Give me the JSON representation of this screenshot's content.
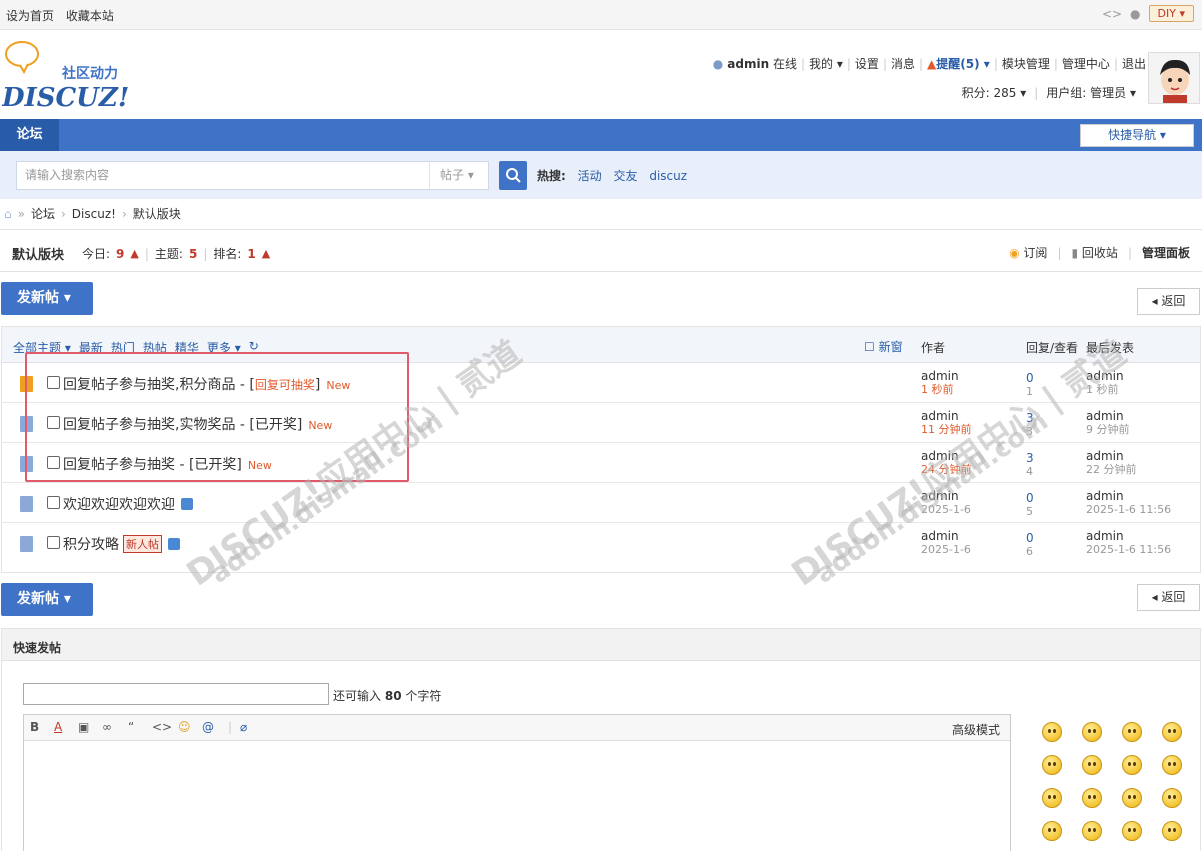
{
  "topbar": {
    "set_home": "设为首页",
    "bookmark": "收藏本站",
    "diy": "DIY"
  },
  "header": {
    "logo_text": "社区动力",
    "logo_word": "DISCUZ!",
    "user": "admin",
    "online": "在线",
    "mine": "我的",
    "settings": "设置",
    "messages": "消息",
    "remind": "提醒(5)",
    "module_manage": "模块管理",
    "admin_center": "管理中心",
    "logout": "退出",
    "credits": "积分: 285",
    "usergroup": "用户组: 管理员"
  },
  "nav": {
    "forum_tab": "论坛",
    "quick_nav": "快捷导航"
  },
  "search": {
    "placeholder": "请输入搜索内容",
    "type": "帖子",
    "hot_label": "热搜:",
    "hot": [
      "活动",
      "交友",
      "discuz"
    ]
  },
  "breadcrumb": [
    "论坛",
    "Discuz!",
    "默认版块"
  ],
  "forum": {
    "name": "默认版块",
    "today_label": "今日:",
    "today": "9",
    "topics_label": "主题:",
    "topics": "5",
    "rank_label": "排名:",
    "rank": "1",
    "subscribe": "订阅",
    "recycle": "回收站",
    "manage_panel": "管理面板"
  },
  "buttons": {
    "new_post": "发新帖",
    "back": "返回"
  },
  "threadlist": {
    "filters": [
      "全部主题",
      "最新",
      "热门",
      "热帖",
      "精华",
      "更多"
    ],
    "new_window": "新窗",
    "col_author": "作者",
    "col_reply": "回复/查看",
    "col_last": "最后发表",
    "rows": [
      {
        "title": "回复帖子参与抽奖,积分商品 - [",
        "tag": "回复可抽奖",
        "tag_close": "]",
        "new": "New",
        "author": "admin",
        "date": "1 秒前",
        "replies": "0",
        "views": "1",
        "last_user": "admin",
        "last_date": "1 秒前"
      },
      {
        "title": "回复帖子参与抽奖,实物奖品 - [已开奖]",
        "new": "New",
        "author": "admin",
        "date": "11 分钟前",
        "replies": "3",
        "views": "3",
        "last_user": "admin",
        "last_date": "9 分钟前"
      },
      {
        "title": "回复帖子参与抽奖 - [已开奖]",
        "new": "New",
        "author": "admin",
        "date": "24 分钟前",
        "replies": "3",
        "views": "4",
        "last_user": "admin",
        "last_date": "22 分钟前"
      },
      {
        "title": "欢迎欢迎欢迎欢迎",
        "author": "admin",
        "date": "2025-1-6",
        "replies": "0",
        "views": "5",
        "last_user": "admin",
        "last_date": "2025-1-6 11:56"
      },
      {
        "title": "积分攻略",
        "badge": "新人帖",
        "author": "admin",
        "date": "2025-1-6",
        "replies": "0",
        "views": "6",
        "last_user": "admin",
        "last_date": "2025-1-6 11:56"
      }
    ]
  },
  "quickpost": {
    "title": "快速发帖",
    "remain_prefix": "还可输入",
    "remain_count": "80",
    "remain_suffix": "个字符",
    "advanced": "高级模式"
  },
  "watermark": {
    "line1": "DISCUZ!应用中心 | 贰道",
    "line2": "addon.dismall.com"
  }
}
